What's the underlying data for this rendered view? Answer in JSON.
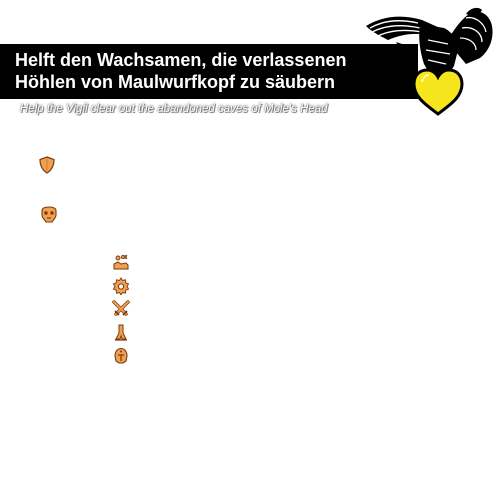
{
  "quest": {
    "title": "Helft den Wachsamen, die verlassenen Höhlen von Maulwurfkopf zu säubern",
    "translation": "Help the Vigil clear out the abandoned caves of Mole's Head"
  },
  "colors": {
    "banner": "#000000",
    "heart": "#f6e51c",
    "icon_fill": "#f0a050",
    "icon_outline": "#7a3a10",
    "title_text": "#ffffff"
  },
  "icons": {
    "emblem": "eagle-emblem-icon",
    "heart": "heart-icon",
    "shield": "shield-icon",
    "skull": "skull-icon",
    "loot": "hand-loot-icon",
    "gear": "gear-icon",
    "swords": "crossed-swords-icon",
    "trap": "trap-icon",
    "helmet": "helmet-icon"
  }
}
